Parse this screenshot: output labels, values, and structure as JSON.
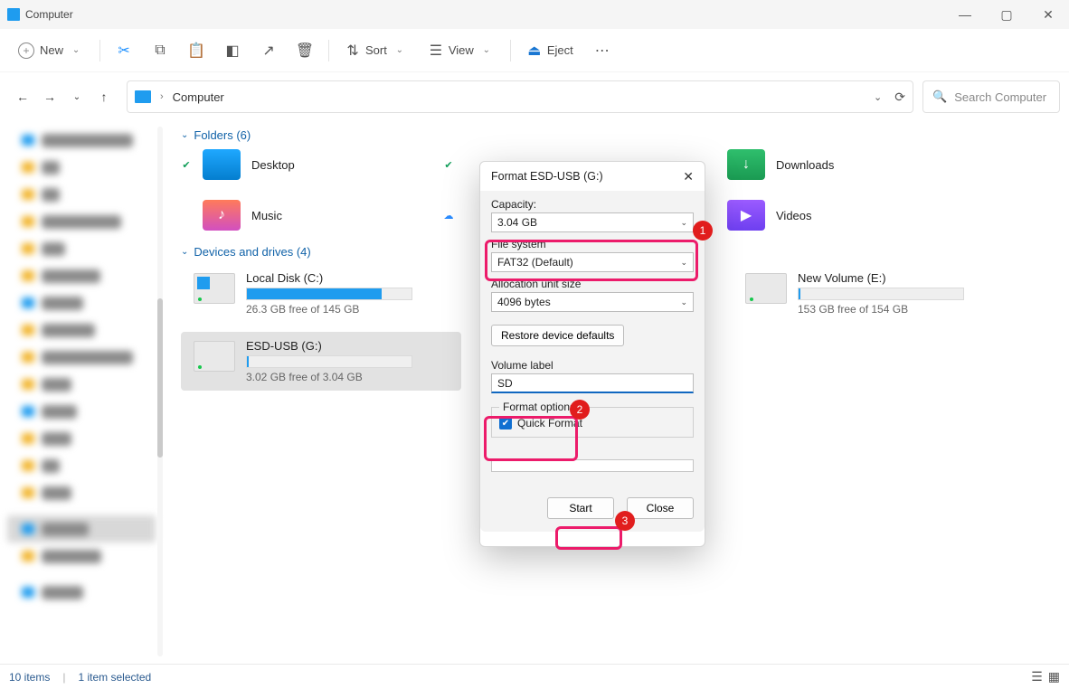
{
  "window": {
    "title": "Computer"
  },
  "toolbar": {
    "new": "New",
    "sort": "Sort",
    "view": "View",
    "eject": "Eject"
  },
  "address": {
    "crumb": "Computer",
    "search_placeholder": "Search Computer"
  },
  "sections": {
    "folders_header": "Folders (6)",
    "drives_header": "Devices and drives (4)"
  },
  "folders": {
    "desktop": "Desktop",
    "music": "Music",
    "downloads": "Downloads",
    "videos": "Videos"
  },
  "drives": {
    "c": {
      "name": "Local Disk (C:)",
      "free": "26.3 GB free of 145 GB",
      "fill_pct": 82
    },
    "e": {
      "name": "New Volume (E:)",
      "free": "153 GB free of 154 GB",
      "fill_pct": 1
    },
    "g": {
      "name": "ESD-USB (G:)",
      "free": "3.02 GB free of 3.04 GB",
      "fill_pct": 1
    }
  },
  "status": {
    "items": "10 items",
    "selection": "1 item selected"
  },
  "dialog": {
    "title": "Format ESD-USB (G:)",
    "capacity_label": "Capacity:",
    "capacity_value": "3.04 GB",
    "filesystem_label": "File system",
    "filesystem_value": "FAT32 (Default)",
    "alloc_label": "Allocation unit size",
    "alloc_value": "4096 bytes",
    "restore_btn": "Restore device defaults",
    "volume_label": "Volume label",
    "volume_value": "SD",
    "options_legend": "Format options",
    "quick_format": "Quick Format",
    "start": "Start",
    "close": "Close"
  },
  "annotations": {
    "a1": "1",
    "a2": "2",
    "a3": "3"
  }
}
